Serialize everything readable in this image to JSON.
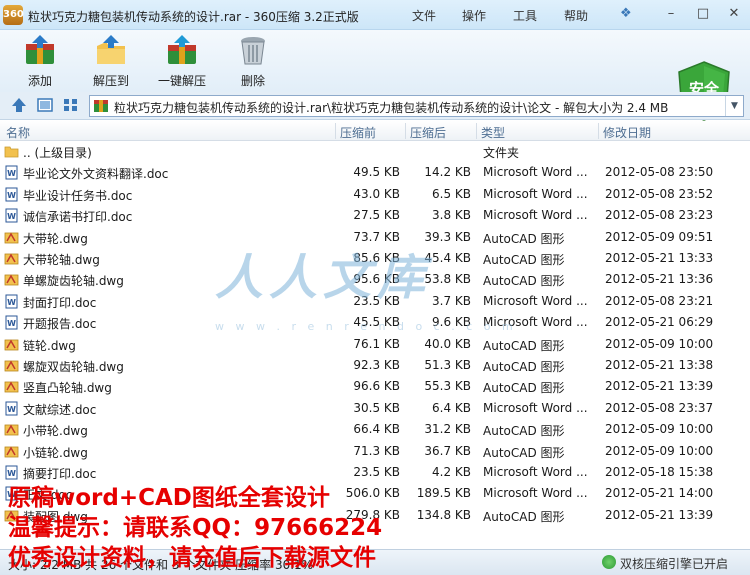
{
  "window": {
    "title": "粒状巧克力糖包装机传动系统的设计.rar - 360压缩 3.2正式版",
    "logo_text": "360",
    "menu": [
      "文件",
      "操作",
      "工具",
      "帮助"
    ],
    "controls": {
      "minimize": "–",
      "maximize": "□",
      "close": "✕"
    }
  },
  "toolbar": {
    "buttons": [
      {
        "label": "添加",
        "icon": "add-archive-icon"
      },
      {
        "label": "解压到",
        "icon": "extract-to-icon"
      },
      {
        "label": "一键解压",
        "icon": "one-click-extract-icon"
      },
      {
        "label": "删除",
        "icon": "delete-trash-icon"
      }
    ],
    "security_label": "安全"
  },
  "address": {
    "path": "粒状巧克力糖包装机传动系统的设计.rar\\粒状巧克力糖包装机传动系统的设计\\论文 - 解包大小为 2.4 MB"
  },
  "columns": {
    "name": "名称",
    "size": "压缩前",
    "compressed": "压缩后",
    "type": "类型",
    "modified": "修改日期"
  },
  "files": [
    {
      "name": ".. (上级目录)",
      "size": "",
      "compressed": "",
      "type": "文件夹",
      "modified": "",
      "kind": "folder"
    },
    {
      "name": "毕业论文外文资料翻译.doc",
      "size": "49.5 KB",
      "compressed": "14.2 KB",
      "type": "Microsoft Word ...",
      "modified": "2012-05-08 23:50",
      "kind": "doc"
    },
    {
      "name": "毕业设计任务书.doc",
      "size": "43.0 KB",
      "compressed": "6.5 KB",
      "type": "Microsoft Word ...",
      "modified": "2012-05-08 23:52",
      "kind": "doc"
    },
    {
      "name": "诚信承诺书打印.doc",
      "size": "27.5 KB",
      "compressed": "3.8 KB",
      "type": "Microsoft Word ...",
      "modified": "2012-05-08 23:23",
      "kind": "doc"
    },
    {
      "name": "大带轮.dwg",
      "size": "73.7 KB",
      "compressed": "39.3 KB",
      "type": "AutoCAD 图形",
      "modified": "2012-05-09 09:51",
      "kind": "dwg"
    },
    {
      "name": "大带轮轴.dwg",
      "size": "85.6 KB",
      "compressed": "45.4 KB",
      "type": "AutoCAD 图形",
      "modified": "2012-05-21 13:33",
      "kind": "dwg"
    },
    {
      "name": "单螺旋齿轮轴.dwg",
      "size": "95.6 KB",
      "compressed": "53.8 KB",
      "type": "AutoCAD 图形",
      "modified": "2012-05-21 13:36",
      "kind": "dwg"
    },
    {
      "name": "封面打印.doc",
      "size": "23.5 KB",
      "compressed": "3.7 KB",
      "type": "Microsoft Word ...",
      "modified": "2012-05-08 23:21",
      "kind": "doc"
    },
    {
      "name": "开题报告.doc",
      "size": "45.5 KB",
      "compressed": "9.6 KB",
      "type": "Microsoft Word ...",
      "modified": "2012-05-21 06:29",
      "kind": "doc"
    },
    {
      "name": "链轮.dwg",
      "size": "76.1 KB",
      "compressed": "40.0 KB",
      "type": "AutoCAD 图形",
      "modified": "2012-05-09 10:00",
      "kind": "dwg"
    },
    {
      "name": "螺旋双齿轮轴.dwg",
      "size": "92.3 KB",
      "compressed": "51.3 KB",
      "type": "AutoCAD 图形",
      "modified": "2012-05-21 13:38",
      "kind": "dwg"
    },
    {
      "name": "竖直凸轮轴.dwg",
      "size": "96.6 KB",
      "compressed": "55.3 KB",
      "type": "AutoCAD 图形",
      "modified": "2012-05-21 13:39",
      "kind": "dwg"
    },
    {
      "name": "文献综述.doc",
      "size": "30.5 KB",
      "compressed": "6.4 KB",
      "type": "Microsoft Word ...",
      "modified": "2012-05-08 23:37",
      "kind": "doc"
    },
    {
      "name": "小带轮.dwg",
      "size": "66.4 KB",
      "compressed": "31.2 KB",
      "type": "AutoCAD 图形",
      "modified": "2012-05-09 10:00",
      "kind": "dwg"
    },
    {
      "name": "小链轮.dwg",
      "size": "71.3 KB",
      "compressed": "36.7 KB",
      "type": "AutoCAD 图形",
      "modified": "2012-05-09 10:00",
      "kind": "dwg"
    },
    {
      "name": "摘要打印.doc",
      "size": "23.5 KB",
      "compressed": "4.2 KB",
      "type": "Microsoft Word ...",
      "modified": "2012-05-18 15:38",
      "kind": "doc"
    },
    {
      "name": "正文.doc",
      "size": "506.0 KB",
      "compressed": "189.5 KB",
      "type": "Microsoft Word ...",
      "modified": "2012-05-21 14:00",
      "kind": "doc"
    },
    {
      "name": "装配图.dwg",
      "size": "279.8 KB",
      "compressed": "134.8 KB",
      "type": "AutoCAD 图形",
      "modified": "2012-05-21 13:39",
      "kind": "dwg"
    }
  ],
  "watermark": {
    "text": "人人文库",
    "url": "w w w . r e n r e n d o c . c o m"
  },
  "status": {
    "left": "大小: 2.2 MB 共 26 个文件和 3 个文件夹 压缩率 30.1%",
    "right": "双核压缩引擎已开启"
  },
  "overlay": {
    "line1": "原稿word+CAD图纸全套设计",
    "line2": "温馨提示：请联系QQ：97666224",
    "line3": "优秀设计资料，请充值后下载源文件"
  },
  "colors": {
    "accent": "#3a78b8",
    "overlay_text": "#e60000",
    "security_shield": "#3aa63a"
  }
}
